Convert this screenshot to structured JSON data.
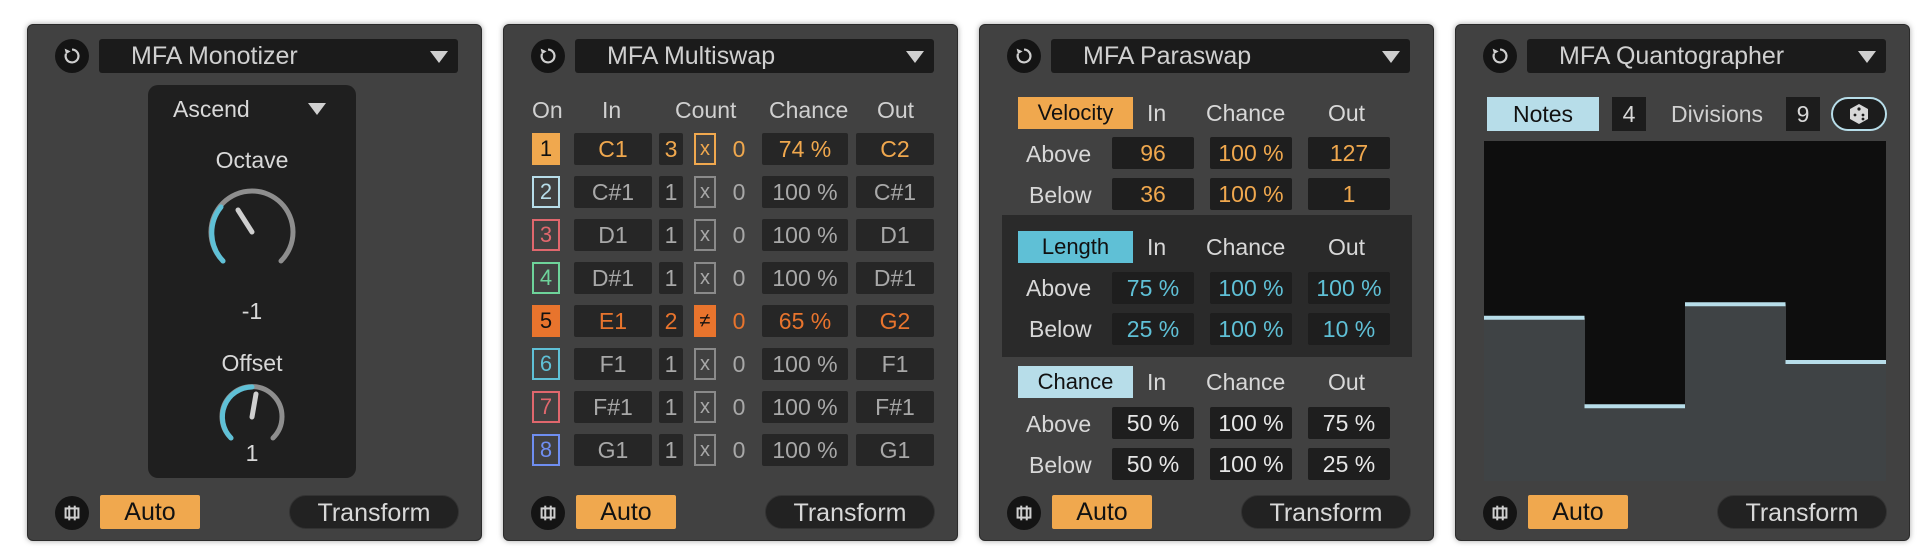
{
  "panels": [
    {
      "title": "MFA Monotizer",
      "auto": "Auto",
      "transform": "Transform"
    },
    {
      "title": "MFA Multiswap",
      "auto": "Auto",
      "transform": "Transform"
    },
    {
      "title": "MFA Paraswap",
      "auto": "Auto",
      "transform": "Transform"
    },
    {
      "title": "MFA Quantographer",
      "auto": "Auto",
      "transform": "Transform"
    }
  ],
  "monotizer": {
    "mode": "Ascend",
    "octave_label": "Octave",
    "octave_value": "-1",
    "offset_label": "Offset",
    "offset_value": "1"
  },
  "multiswap": {
    "headers": {
      "on": "On",
      "in": "In",
      "count": "Count",
      "chance": "Chance",
      "out": "Out"
    },
    "rows": [
      {
        "n": "1",
        "in": "C1",
        "count": "3",
        "mode": "x",
        "zero": "0",
        "chance": "74 %",
        "out": "C2",
        "color": "#f0a84e",
        "active": true,
        "filled": true
      },
      {
        "n": "2",
        "in": "C#1",
        "count": "1",
        "mode": "x",
        "zero": "0",
        "chance": "100 %",
        "out": "C#1",
        "color": "#b7dde9",
        "active": false
      },
      {
        "n": "3",
        "in": "D1",
        "count": "1",
        "mode": "x",
        "zero": "0",
        "chance": "100 %",
        "out": "D1",
        "color": "#e0676d",
        "active": false
      },
      {
        "n": "4",
        "in": "D#1",
        "count": "1",
        "mode": "x",
        "zero": "0",
        "chance": "100 %",
        "out": "D#1",
        "color": "#6ed39a",
        "active": false
      },
      {
        "n": "5",
        "in": "E1",
        "count": "2",
        "mode": "≠",
        "zero": "0",
        "chance": "65 %",
        "out": "G2",
        "color": "#e8742d",
        "active": true,
        "filled": true,
        "ne": true
      },
      {
        "n": "6",
        "in": "F1",
        "count": "1",
        "mode": "x",
        "zero": "0",
        "chance": "100 %",
        "out": "F1",
        "color": "#5fc0d6",
        "active": false
      },
      {
        "n": "7",
        "in": "F#1",
        "count": "1",
        "mode": "x",
        "zero": "0",
        "chance": "100 %",
        "out": "F#1",
        "color": "#e0676d",
        "active": false
      },
      {
        "n": "8",
        "in": "G1",
        "count": "1",
        "mode": "x",
        "zero": "0",
        "chance": "100 %",
        "out": "G1",
        "color": "#6f8ef0",
        "active": false
      }
    ]
  },
  "paraswap": {
    "col_in": "In",
    "col_chance": "Chance",
    "col_out": "Out",
    "above": "Above",
    "below": "Below",
    "groups": [
      {
        "name": "Velocity",
        "above": [
          "96",
          "100 %",
          "127"
        ],
        "below": [
          "36",
          "100 %",
          "1"
        ]
      },
      {
        "name": "Length",
        "above": [
          "75 %",
          "100 %",
          "100 %"
        ],
        "below": [
          "25 %",
          "100 %",
          "10 %"
        ]
      },
      {
        "name": "Chance",
        "above": [
          "50 %",
          "100 %",
          "75 %"
        ],
        "below": [
          "50 %",
          "100 %",
          "25 %"
        ]
      }
    ]
  },
  "quantographer": {
    "notes_label": "Notes",
    "notes_value": "4",
    "divisions_label": "Divisions",
    "divisions_value": "9",
    "steps": [
      0.48,
      0.22,
      0.52,
      0.35
    ]
  },
  "colors": {
    "orange": "#f0a84e",
    "light_blue": "#b7dde9",
    "cyan": "#5fc0d6"
  }
}
